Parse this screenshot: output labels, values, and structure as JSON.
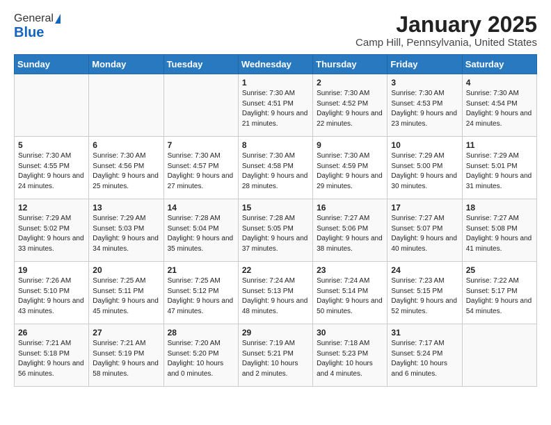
{
  "logo": {
    "general": "General",
    "blue": "Blue"
  },
  "title": "January 2025",
  "subtitle": "Camp Hill, Pennsylvania, United States",
  "weekdays": [
    "Sunday",
    "Monday",
    "Tuesday",
    "Wednesday",
    "Thursday",
    "Friday",
    "Saturday"
  ],
  "weeks": [
    [
      {
        "day": "",
        "info": ""
      },
      {
        "day": "",
        "info": ""
      },
      {
        "day": "",
        "info": ""
      },
      {
        "day": "1",
        "info": "Sunrise: 7:30 AM\nSunset: 4:51 PM\nDaylight: 9 hours\nand 21 minutes."
      },
      {
        "day": "2",
        "info": "Sunrise: 7:30 AM\nSunset: 4:52 PM\nDaylight: 9 hours\nand 22 minutes."
      },
      {
        "day": "3",
        "info": "Sunrise: 7:30 AM\nSunset: 4:53 PM\nDaylight: 9 hours\nand 23 minutes."
      },
      {
        "day": "4",
        "info": "Sunrise: 7:30 AM\nSunset: 4:54 PM\nDaylight: 9 hours\nand 24 minutes."
      }
    ],
    [
      {
        "day": "5",
        "info": "Sunrise: 7:30 AM\nSunset: 4:55 PM\nDaylight: 9 hours\nand 24 minutes."
      },
      {
        "day": "6",
        "info": "Sunrise: 7:30 AM\nSunset: 4:56 PM\nDaylight: 9 hours\nand 25 minutes."
      },
      {
        "day": "7",
        "info": "Sunrise: 7:30 AM\nSunset: 4:57 PM\nDaylight: 9 hours\nand 27 minutes."
      },
      {
        "day": "8",
        "info": "Sunrise: 7:30 AM\nSunset: 4:58 PM\nDaylight: 9 hours\nand 28 minutes."
      },
      {
        "day": "9",
        "info": "Sunrise: 7:30 AM\nSunset: 4:59 PM\nDaylight: 9 hours\nand 29 minutes."
      },
      {
        "day": "10",
        "info": "Sunrise: 7:29 AM\nSunset: 5:00 PM\nDaylight: 9 hours\nand 30 minutes."
      },
      {
        "day": "11",
        "info": "Sunrise: 7:29 AM\nSunset: 5:01 PM\nDaylight: 9 hours\nand 31 minutes."
      }
    ],
    [
      {
        "day": "12",
        "info": "Sunrise: 7:29 AM\nSunset: 5:02 PM\nDaylight: 9 hours\nand 33 minutes."
      },
      {
        "day": "13",
        "info": "Sunrise: 7:29 AM\nSunset: 5:03 PM\nDaylight: 9 hours\nand 34 minutes."
      },
      {
        "day": "14",
        "info": "Sunrise: 7:28 AM\nSunset: 5:04 PM\nDaylight: 9 hours\nand 35 minutes."
      },
      {
        "day": "15",
        "info": "Sunrise: 7:28 AM\nSunset: 5:05 PM\nDaylight: 9 hours\nand 37 minutes."
      },
      {
        "day": "16",
        "info": "Sunrise: 7:27 AM\nSunset: 5:06 PM\nDaylight: 9 hours\nand 38 minutes."
      },
      {
        "day": "17",
        "info": "Sunrise: 7:27 AM\nSunset: 5:07 PM\nDaylight: 9 hours\nand 40 minutes."
      },
      {
        "day": "18",
        "info": "Sunrise: 7:27 AM\nSunset: 5:08 PM\nDaylight: 9 hours\nand 41 minutes."
      }
    ],
    [
      {
        "day": "19",
        "info": "Sunrise: 7:26 AM\nSunset: 5:10 PM\nDaylight: 9 hours\nand 43 minutes."
      },
      {
        "day": "20",
        "info": "Sunrise: 7:25 AM\nSunset: 5:11 PM\nDaylight: 9 hours\nand 45 minutes."
      },
      {
        "day": "21",
        "info": "Sunrise: 7:25 AM\nSunset: 5:12 PM\nDaylight: 9 hours\nand 47 minutes."
      },
      {
        "day": "22",
        "info": "Sunrise: 7:24 AM\nSunset: 5:13 PM\nDaylight: 9 hours\nand 48 minutes."
      },
      {
        "day": "23",
        "info": "Sunrise: 7:24 AM\nSunset: 5:14 PM\nDaylight: 9 hours\nand 50 minutes."
      },
      {
        "day": "24",
        "info": "Sunrise: 7:23 AM\nSunset: 5:15 PM\nDaylight: 9 hours\nand 52 minutes."
      },
      {
        "day": "25",
        "info": "Sunrise: 7:22 AM\nSunset: 5:17 PM\nDaylight: 9 hours\nand 54 minutes."
      }
    ],
    [
      {
        "day": "26",
        "info": "Sunrise: 7:21 AM\nSunset: 5:18 PM\nDaylight: 9 hours\nand 56 minutes."
      },
      {
        "day": "27",
        "info": "Sunrise: 7:21 AM\nSunset: 5:19 PM\nDaylight: 9 hours\nand 58 minutes."
      },
      {
        "day": "28",
        "info": "Sunrise: 7:20 AM\nSunset: 5:20 PM\nDaylight: 10 hours\nand 0 minutes."
      },
      {
        "day": "29",
        "info": "Sunrise: 7:19 AM\nSunset: 5:21 PM\nDaylight: 10 hours\nand 2 minutes."
      },
      {
        "day": "30",
        "info": "Sunrise: 7:18 AM\nSunset: 5:23 PM\nDaylight: 10 hours\nand 4 minutes."
      },
      {
        "day": "31",
        "info": "Sunrise: 7:17 AM\nSunset: 5:24 PM\nDaylight: 10 hours\nand 6 minutes."
      },
      {
        "day": "",
        "info": ""
      }
    ]
  ]
}
